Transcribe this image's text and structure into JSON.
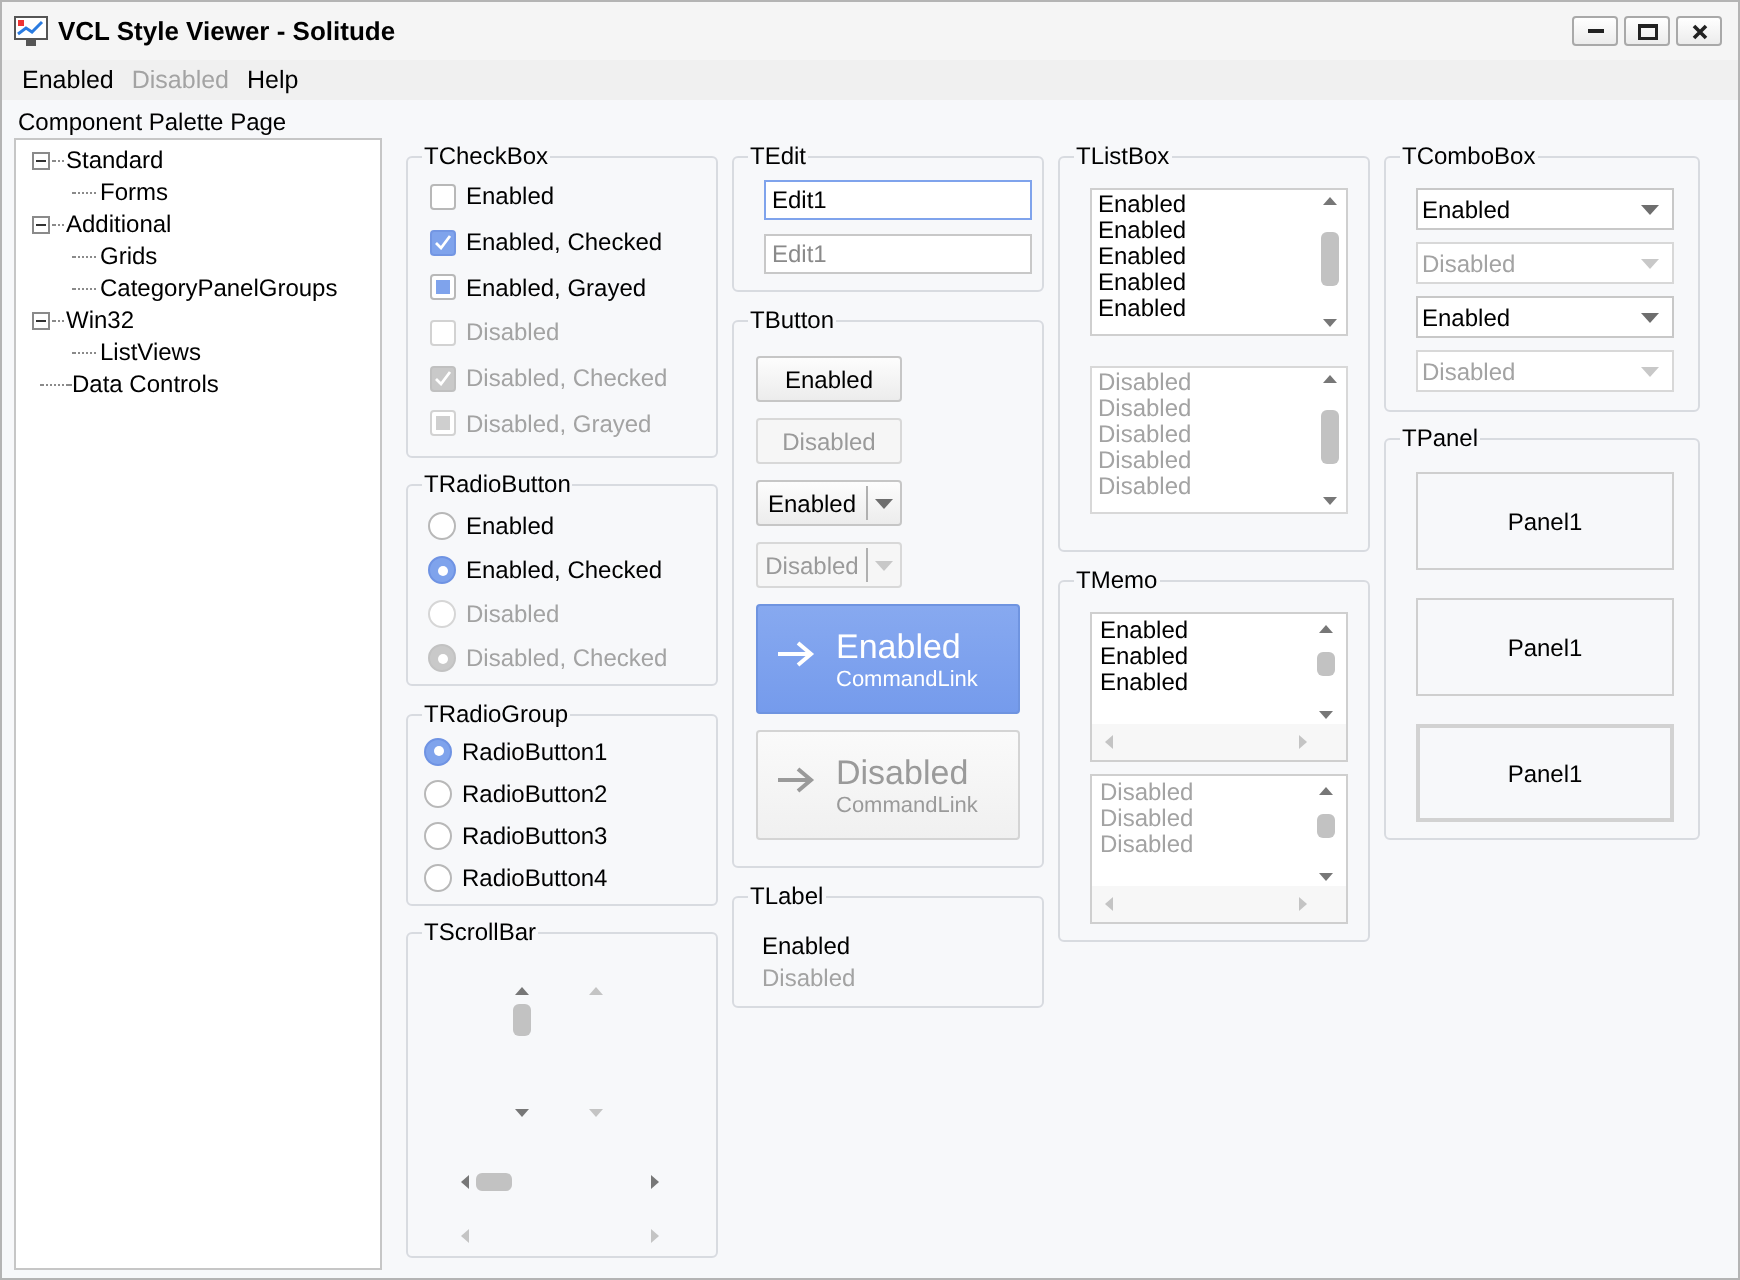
{
  "window": {
    "title": "VCL Style Viewer - Solitude"
  },
  "menu": [
    {
      "label": "Enabled",
      "disabled": false
    },
    {
      "label": "Disabled",
      "disabled": true
    },
    {
      "label": "Help",
      "disabled": false
    }
  ],
  "palette": {
    "title": "Component Palette Page",
    "tree": [
      {
        "label": "Standard",
        "expanded": true,
        "children": [
          {
            "label": "Forms"
          }
        ]
      },
      {
        "label": "Additional",
        "expanded": true,
        "children": [
          {
            "label": "Grids"
          },
          {
            "label": "CategoryPanelGroups"
          }
        ]
      },
      {
        "label": "Win32",
        "expanded": true,
        "children": [
          {
            "label": "ListViews"
          }
        ]
      },
      {
        "label": "Data Controls"
      }
    ]
  },
  "checkboxes": {
    "title": "TCheckBox",
    "items": [
      {
        "label": "Enabled",
        "kind": "unchecked",
        "disabled": false
      },
      {
        "label": "Enabled, Checked",
        "kind": "checked",
        "disabled": false
      },
      {
        "label": "Enabled, Grayed",
        "kind": "grayed",
        "disabled": false
      },
      {
        "label": "Disabled",
        "kind": "unchecked",
        "disabled": true
      },
      {
        "label": "Disabled, Checked",
        "kind": "checked",
        "disabled": true
      },
      {
        "label": "Disabled, Grayed",
        "kind": "grayed",
        "disabled": true
      }
    ]
  },
  "radio_buttons": {
    "title": "TRadioButton",
    "items": [
      {
        "label": "Enabled",
        "selected": false,
        "disabled": false
      },
      {
        "label": "Enabled, Checked",
        "selected": true,
        "disabled": false
      },
      {
        "label": "Disabled",
        "selected": false,
        "disabled": true
      },
      {
        "label": "Disabled, Checked",
        "selected": true,
        "disabled": true
      }
    ]
  },
  "radio_group": {
    "title": "TRadioGroup",
    "items": [
      {
        "label": "RadioButton1",
        "selected": true
      },
      {
        "label": "RadioButton2",
        "selected": false
      },
      {
        "label": "RadioButton3",
        "selected": false
      },
      {
        "label": "RadioButton4",
        "selected": false
      }
    ]
  },
  "scrollbars": {
    "title": "TScrollBar",
    "bars": [
      {
        "kind": "vertical",
        "disabled": false
      },
      {
        "kind": "vertical",
        "disabled": true
      },
      {
        "kind": "horizontal",
        "disabled": false
      },
      {
        "kind": "horizontal",
        "disabled": true
      }
    ]
  },
  "edits": {
    "title": "TEdit",
    "fields": [
      {
        "value": "Edit1",
        "disabled": false,
        "focused": true
      },
      {
        "value": "Edit1",
        "disabled": true,
        "focused": false
      }
    ]
  },
  "buttons": {
    "title": "TButton",
    "items": [
      {
        "kind": "push",
        "label": "Enabled",
        "disabled": false
      },
      {
        "kind": "push",
        "label": "Disabled",
        "disabled": true
      },
      {
        "kind": "split",
        "label": "Enabled",
        "disabled": false
      },
      {
        "kind": "split",
        "label": "Disabled",
        "disabled": true
      },
      {
        "kind": "command_link",
        "label": "Enabled",
        "note": "CommandLink",
        "disabled": false
      },
      {
        "kind": "command_link",
        "label": "Disabled",
        "note": "CommandLink",
        "disabled": true
      }
    ]
  },
  "labels": {
    "title": "TLabel",
    "items": [
      {
        "text": "Enabled",
        "disabled": false
      },
      {
        "text": "Disabled",
        "disabled": true
      }
    ]
  },
  "listboxes": {
    "title": "TListBox",
    "boxes": [
      {
        "disabled": false,
        "items": [
          "Enabled",
          "Enabled",
          "Enabled",
          "Enabled",
          "Enabled"
        ]
      },
      {
        "disabled": true,
        "items": [
          "Disabled",
          "Disabled",
          "Disabled",
          "Disabled",
          "Disabled"
        ]
      }
    ]
  },
  "memos": {
    "title": "TMemo",
    "boxes": [
      {
        "disabled": false,
        "lines": [
          "Enabled",
          "Enabled",
          "Enabled"
        ]
      },
      {
        "disabled": true,
        "lines": [
          "Disabled",
          "Disabled",
          "Disabled"
        ]
      }
    ]
  },
  "comboboxes": {
    "title": "TComboBox",
    "items": [
      {
        "value": "Enabled",
        "disabled": false
      },
      {
        "value": "Disabled",
        "disabled": true
      },
      {
        "value": "Enabled",
        "disabled": false
      },
      {
        "value": "Disabled",
        "disabled": true
      }
    ]
  },
  "panels": {
    "title": "TPanel",
    "items": [
      {
        "caption": "Panel1",
        "thick_border": false
      },
      {
        "caption": "Panel1",
        "thick_border": false
      },
      {
        "caption": "Panel1",
        "thick_border": true
      }
    ]
  }
}
